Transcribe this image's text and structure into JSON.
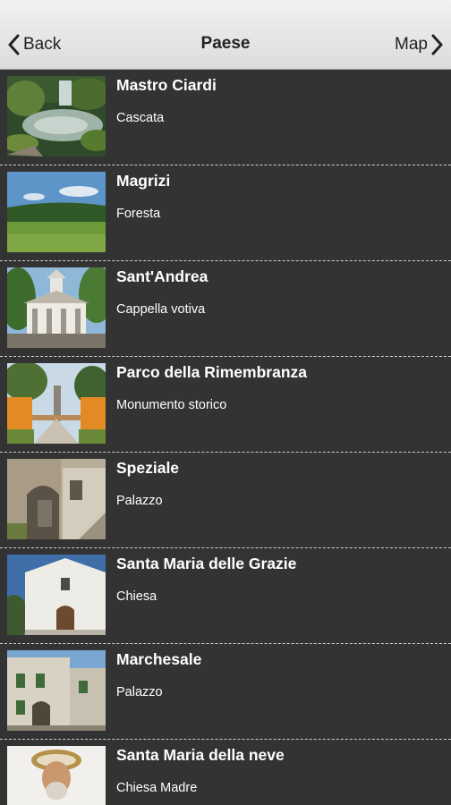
{
  "header": {
    "back_label": "Back",
    "title": "Paese",
    "map_label": "Map"
  },
  "places": [
    {
      "name": "Mastro Ciardi",
      "type": "Cascata",
      "image": "waterfall-photo"
    },
    {
      "name": "Magrizi",
      "type": "Foresta",
      "image": "forest-meadow-photo"
    },
    {
      "name": "Sant'Andrea",
      "type": "Cappella votiva",
      "image": "chapel-photo"
    },
    {
      "name": "Parco della Rimembranza",
      "type": "Monumento storico",
      "image": "memorial-park-photo"
    },
    {
      "name": "Speziale",
      "type": "Palazzo",
      "image": "palazzo-archway-photo"
    },
    {
      "name": "Santa Maria delle Grazie",
      "type": "Chiesa",
      "image": "church-facade-photo"
    },
    {
      "name": "Marchesale",
      "type": "Palazzo",
      "image": "palazzo-building-photo"
    },
    {
      "name": "Santa Maria della neve",
      "type": "Chiesa Madre",
      "image": "saint-statue-photo"
    }
  ],
  "colors": {
    "navbar": "#e6e6e6",
    "list_background": "#333333",
    "text": "#ffffff",
    "separator": "#cfcfcf"
  }
}
